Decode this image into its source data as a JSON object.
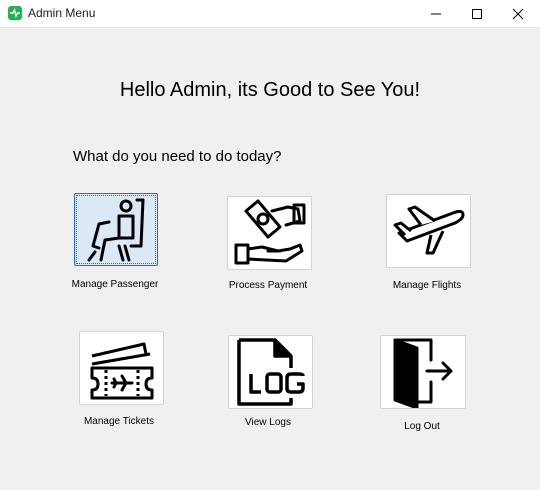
{
  "window": {
    "title": "Admin Menu",
    "controls": [
      "minimize-icon",
      "maximize-icon",
      "close-icon"
    ]
  },
  "main": {
    "greeting": "Hello Admin, its Good to See You!",
    "prompt": "What do you need to do today?"
  },
  "menu": {
    "items": [
      {
        "label": "Manage Passenger",
        "icon": "passenger-seat-icon",
        "selected": true
      },
      {
        "label": "Process Payment",
        "icon": "payment-hand-icon",
        "selected": false
      },
      {
        "label": "Manage Flights",
        "icon": "airplane-icon",
        "selected": false
      },
      {
        "label": "Manage Tickets",
        "icon": "ticket-icon",
        "selected": false
      },
      {
        "label": "View Logs",
        "icon": "log-file-icon",
        "selected": false
      },
      {
        "label": "Log Out",
        "icon": "logout-door-icon",
        "selected": false
      }
    ]
  },
  "colors": {
    "app_icon": "#25b34b",
    "selection_border": "#1e6fd0",
    "selection_fill": "#dbe9f6",
    "window_bg": "#f0f0f0"
  }
}
